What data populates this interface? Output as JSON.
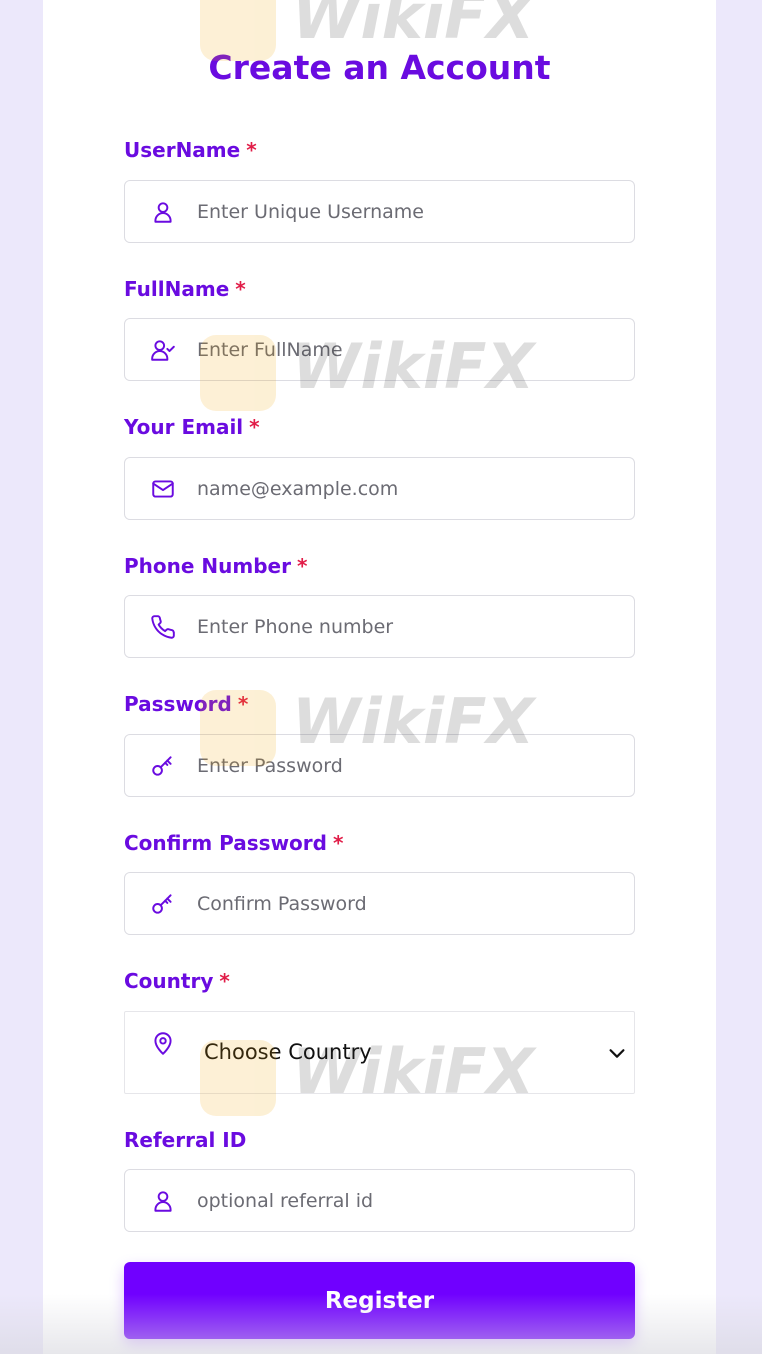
{
  "form": {
    "title": "Create an Account",
    "required_mark": "*",
    "fields": {
      "username": {
        "label": "UserName",
        "placeholder": "Enter Unique Username",
        "icon": "user-icon"
      },
      "fullname": {
        "label": "FullName",
        "placeholder": "Enter FullName",
        "icon": "user-check-icon"
      },
      "email": {
        "label": "Your Email",
        "placeholder": "name@example.com",
        "icon": "mail-icon"
      },
      "phone": {
        "label": "Phone Number",
        "placeholder": "Enter Phone number",
        "icon": "phone-icon"
      },
      "password": {
        "label": "Password",
        "placeholder": "Enter Password",
        "icon": "key-icon"
      },
      "confirm_password": {
        "label": "Confirm Password",
        "placeholder": "Confirm Password",
        "icon": "key-icon"
      },
      "country": {
        "label": "Country",
        "value": "Choose Country",
        "icon": "map-pin-icon"
      },
      "referral": {
        "label": "Referral ID",
        "placeholder": "optional referral id",
        "icon": "user-icon"
      }
    },
    "register_label": "Register"
  },
  "watermark": {
    "text": "WikiFX"
  },
  "colors": {
    "accent": "#6a0be0",
    "button": "#7000ff",
    "required": "#e11d48",
    "background": "#ece8fb"
  }
}
